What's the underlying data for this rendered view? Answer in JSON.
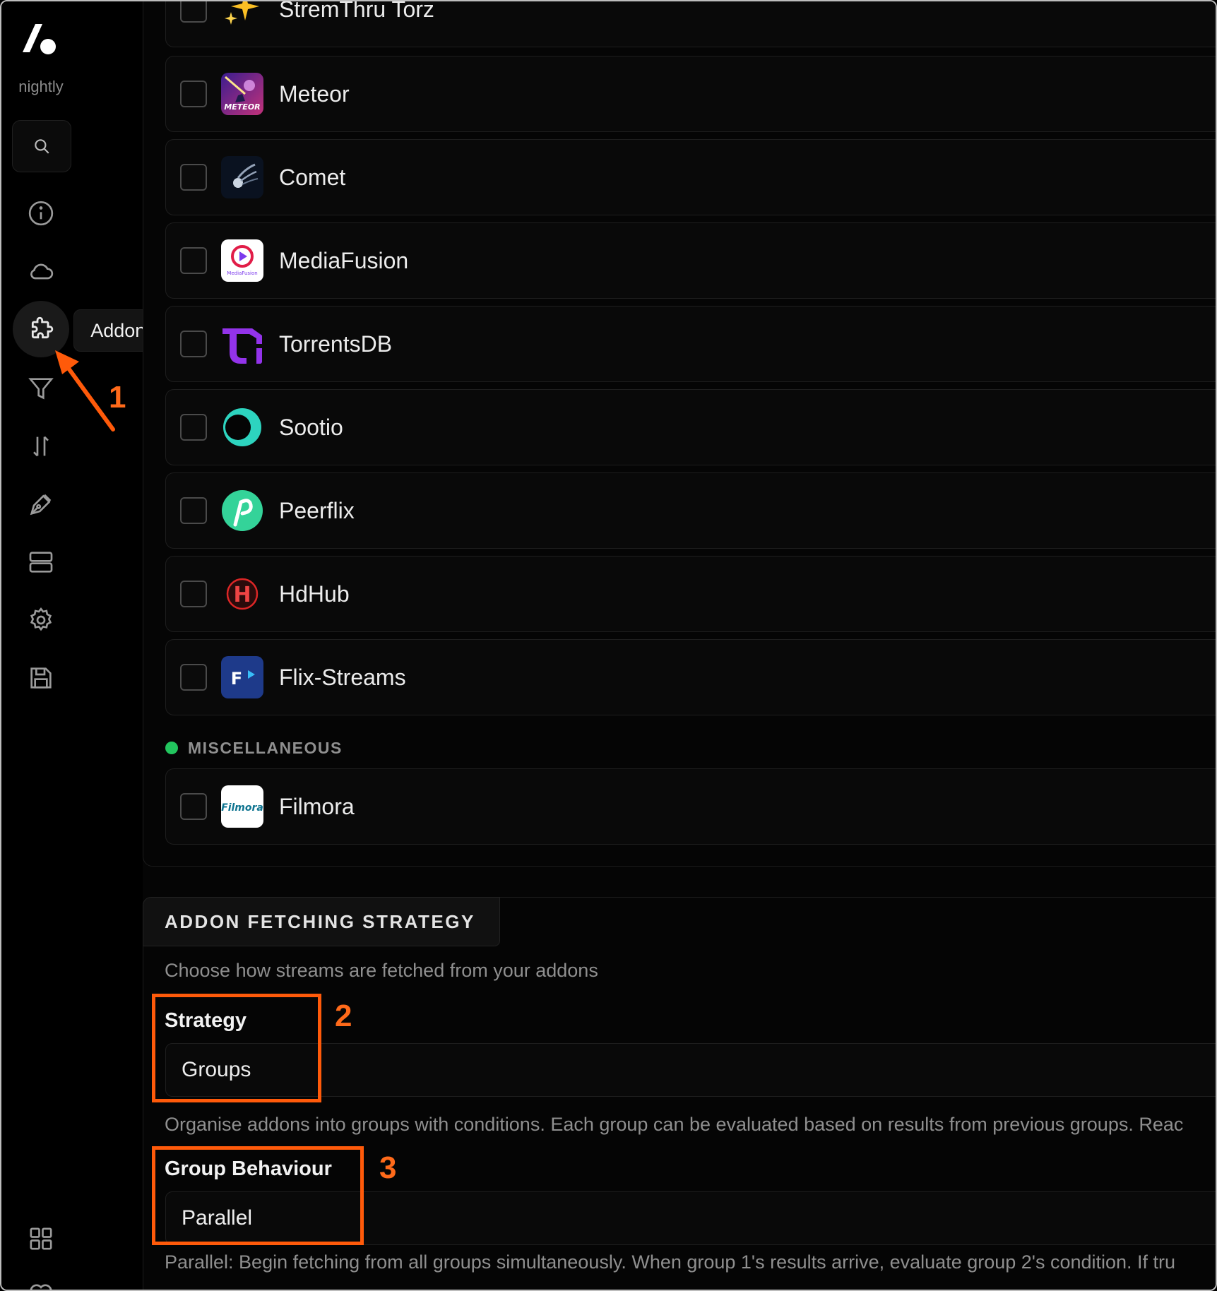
{
  "sidebar": {
    "brand_label": "nightly",
    "nav_icons": [
      "search-icon",
      "info-icon",
      "cloud-icon",
      "puzzle-icon",
      "filter-icon",
      "sort-icon",
      "pen-icon",
      "server-icon",
      "gear-icon",
      "save-icon",
      "grid-icon"
    ],
    "tooltip": "Addons"
  },
  "addons": {
    "items": [
      {
        "name": "StremThru Torz",
        "icon": "sparkles-icon"
      },
      {
        "name": "Meteor",
        "icon": "meteor-logo-icon"
      },
      {
        "name": "Comet",
        "icon": "comet-logo-icon"
      },
      {
        "name": "MediaFusion",
        "icon": "mediafusion-logo-icon"
      },
      {
        "name": "TorrentsDB",
        "icon": "torrentsdb-logo-icon"
      },
      {
        "name": "Sootio",
        "icon": "sootio-logo-icon"
      },
      {
        "name": "Peerflix",
        "icon": "peerflix-logo-icon"
      },
      {
        "name": "HdHub",
        "icon": "hdhub-logo-icon"
      },
      {
        "name": "Flix-Streams",
        "icon": "flix-streams-logo-icon"
      }
    ],
    "misc_section_label": "MISCELLANEOUS",
    "misc_items": [
      {
        "name": "Filmora",
        "icon": "filmora-logo-icon"
      }
    ]
  },
  "strategy": {
    "heading": "ADDON FETCHING STRATEGY",
    "description": "Choose how streams are fetched from your addons",
    "strategy_label": "Strategy",
    "strategy_value": "Groups",
    "strategy_help": "Organise addons into groups with conditions. Each group can be evaluated based on results from previous groups. Reac",
    "behaviour_label": "Group Behaviour",
    "behaviour_value": "Parallel",
    "behaviour_help": "Parallel: Begin fetching from all groups simultaneously. When group 1's results arrive, evaluate group 2's condition. If tru"
  },
  "annotations": {
    "step1": "1",
    "step2": "2",
    "step3": "3",
    "color": "#ff5a0a"
  },
  "colors": {
    "background": "#050505",
    "misc_dot": "#22c55e",
    "annotation": "#ff5a0a"
  }
}
